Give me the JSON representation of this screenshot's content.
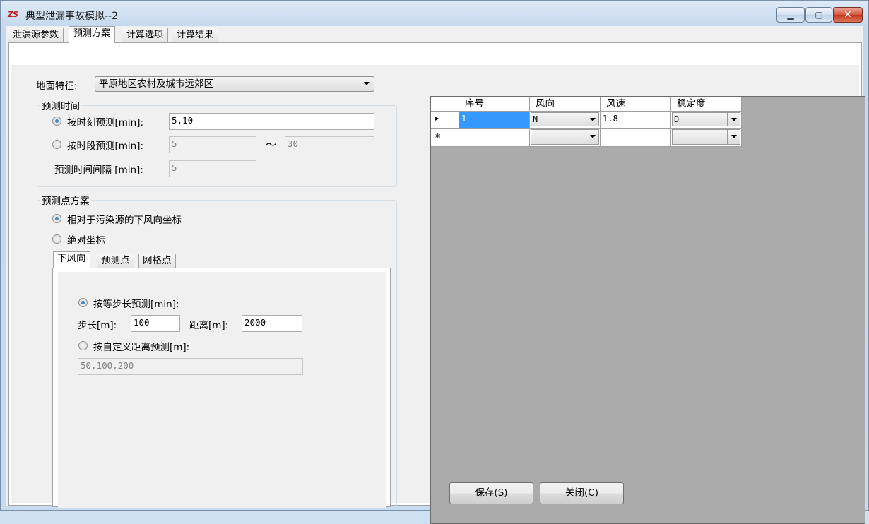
{
  "window": {
    "title": "典型泄漏事故模拟--2",
    "icon": "app-logo-icon",
    "minimize_glyph": "▁",
    "maximize_glyph": "▢",
    "close_glyph": "✕"
  },
  "tabs": [
    "泄漏源参数",
    "预测方案",
    "计算选项",
    "计算结果"
  ],
  "active_tab": "预测方案",
  "ground": {
    "label": "地面特征:",
    "value": "平原地区农村及城市远郊区"
  },
  "time_group": {
    "title": "预测时间",
    "by_moment": {
      "label": "按时刻预测[min]:",
      "value": "5,10",
      "checked": true
    },
    "by_period": {
      "label": "按时段预测[min]:",
      "from": "5",
      "to": "30",
      "separator": "～",
      "checked": false
    },
    "interval": {
      "label": "预测时间间隔 [min]:",
      "value": "5"
    }
  },
  "point_group": {
    "title": "预测点方案",
    "relative": {
      "label": "相对于污染源的下风向坐标",
      "checked": true
    },
    "absolute": {
      "label": "绝对坐标",
      "checked": false
    },
    "subtabs": [
      "下风向",
      "预测点",
      "网格点"
    ],
    "active_subtab": "下风向",
    "equal_step": {
      "label": "按等步长预测[min]:",
      "checked": true
    },
    "step": {
      "label": "步长[m]:",
      "value": "100"
    },
    "distance": {
      "label": "距离[m]:",
      "value": "2000"
    },
    "custom": {
      "label": "按自定义距离预测[m]:",
      "value": "50,100,200",
      "checked": false
    }
  },
  "grid": {
    "columns": [
      "序号",
      "风向",
      "风速",
      "稳定度"
    ],
    "rows": [
      {
        "indicator": "▸",
        "seq": "1",
        "direction": "N",
        "speed": "1.8",
        "stability": "D"
      },
      {
        "indicator": "*",
        "seq": "",
        "direction": "",
        "speed": "",
        "stability": ""
      }
    ]
  },
  "buttons": {
    "save": "保存(S)",
    "close": "关闭(C)"
  },
  "colors": {
    "selection": "#3399ff",
    "grid_background": "#ababab",
    "panel": "#f0f0f0"
  }
}
